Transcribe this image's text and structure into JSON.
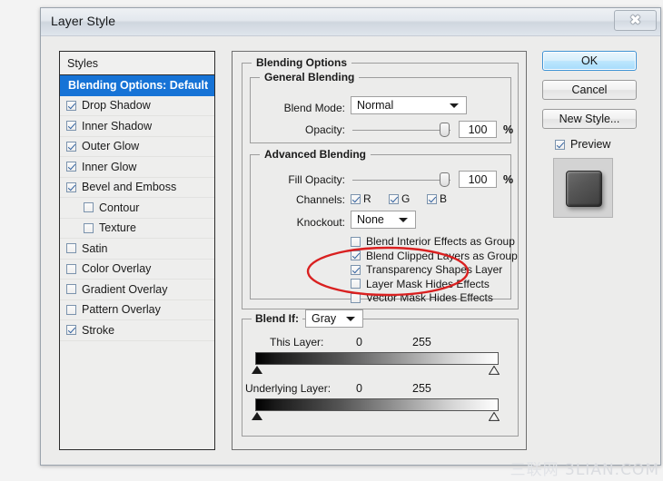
{
  "window": {
    "title": "Layer Style",
    "close_icon": "close-x-icon"
  },
  "styles_panel": {
    "header": "Styles",
    "items": [
      {
        "label": "Blending Options: Default",
        "checked": null,
        "selected": true,
        "sub": false
      },
      {
        "label": "Drop Shadow",
        "checked": true,
        "selected": false,
        "sub": false
      },
      {
        "label": "Inner Shadow",
        "checked": true,
        "selected": false,
        "sub": false
      },
      {
        "label": "Outer Glow",
        "checked": true,
        "selected": false,
        "sub": false
      },
      {
        "label": "Inner Glow",
        "checked": true,
        "selected": false,
        "sub": false
      },
      {
        "label": "Bevel and Emboss",
        "checked": true,
        "selected": false,
        "sub": false
      },
      {
        "label": "Contour",
        "checked": false,
        "selected": false,
        "sub": true
      },
      {
        "label": "Texture",
        "checked": false,
        "selected": false,
        "sub": true
      },
      {
        "label": "Satin",
        "checked": false,
        "selected": false,
        "sub": false
      },
      {
        "label": "Color Overlay",
        "checked": false,
        "selected": false,
        "sub": false
      },
      {
        "label": "Gradient Overlay",
        "checked": false,
        "selected": false,
        "sub": false
      },
      {
        "label": "Pattern Overlay",
        "checked": false,
        "selected": false,
        "sub": false
      },
      {
        "label": "Stroke",
        "checked": true,
        "selected": false,
        "sub": false
      }
    ]
  },
  "blending_options": {
    "group_title": "Blending Options",
    "general": {
      "group_title": "General Blending",
      "blend_mode_label": "Blend Mode:",
      "blend_mode_value": "Normal",
      "opacity_label": "Opacity:",
      "opacity_value": "100",
      "opacity_unit": "%",
      "opacity_percent": 100
    },
    "advanced": {
      "group_title": "Advanced Blending",
      "fill_opacity_label": "Fill Opacity:",
      "fill_opacity_value": "100",
      "fill_opacity_unit": "%",
      "fill_opacity_percent": 100,
      "channels_label": "Channels:",
      "channels": [
        {
          "label": "R",
          "checked": true
        },
        {
          "label": "G",
          "checked": true
        },
        {
          "label": "B",
          "checked": true
        }
      ],
      "knockout_label": "Knockout:",
      "knockout_value": "None",
      "options": [
        {
          "label": "Blend Interior Effects as Group",
          "checked": false
        },
        {
          "label": "Blend Clipped Layers as Group",
          "checked": true
        },
        {
          "label": "Transparency Shapes Layer",
          "checked": true
        },
        {
          "label": "Layer Mask Hides Effects",
          "checked": false
        },
        {
          "label": "Vector Mask Hides Effects",
          "checked": false
        }
      ]
    }
  },
  "blend_if": {
    "label": "Blend If:",
    "channel_value": "Gray",
    "this_layer": {
      "label": "This Layer:",
      "min": "0",
      "max": "255"
    },
    "underlying_layer": {
      "label": "Underlying Layer:",
      "min": "0",
      "max": "255"
    }
  },
  "buttons": {
    "ok": "OK",
    "cancel": "Cancel",
    "new_style": "New Style...",
    "preview_label": "Preview",
    "preview_checked": true
  },
  "annotation": {
    "type": "red-ellipse-highlight",
    "color": "#d92020",
    "targets": [
      "Layer Mask Hides Effects",
      "Vector Mask Hides Effects"
    ]
  },
  "watermark": {
    "cn": "三联网",
    "en": "3LIAN.COM"
  }
}
